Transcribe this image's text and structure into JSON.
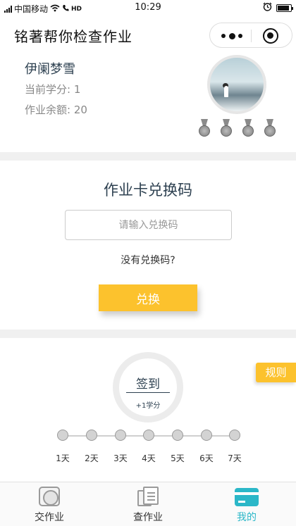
{
  "status_bar": {
    "carrier": "中国移动",
    "network": "HD",
    "time": "10:29"
  },
  "nav": {
    "title": "铭著帮你检查作业"
  },
  "profile": {
    "name": "伊阑梦雪",
    "credits": "当前学分: 1",
    "balance": "作业余额: 20",
    "medal_count": 4
  },
  "redeem": {
    "title": "作业卡兑换码",
    "input_placeholder": "请输入兑换码",
    "input_value": "",
    "help_link": "没有兑换码?",
    "button_label": "兑换"
  },
  "checkin": {
    "rules_label": "规则",
    "button_title": "签到",
    "button_subtitle": "+1学分",
    "days": [
      "1天",
      "2天",
      "3天",
      "4天",
      "5天",
      "6天",
      "7天"
    ]
  },
  "tabbar": {
    "items": [
      {
        "label": "交作业",
        "icon": "camera-icon",
        "active": false
      },
      {
        "label": "查作业",
        "icon": "documents-icon",
        "active": false
      },
      {
        "label": "我的",
        "icon": "card-icon",
        "active": true
      }
    ]
  },
  "colors": {
    "accent": "#fcc22d",
    "active_tab": "#2bb7c8",
    "title_text": "#2d4050",
    "divider": "#f0f0f0"
  }
}
